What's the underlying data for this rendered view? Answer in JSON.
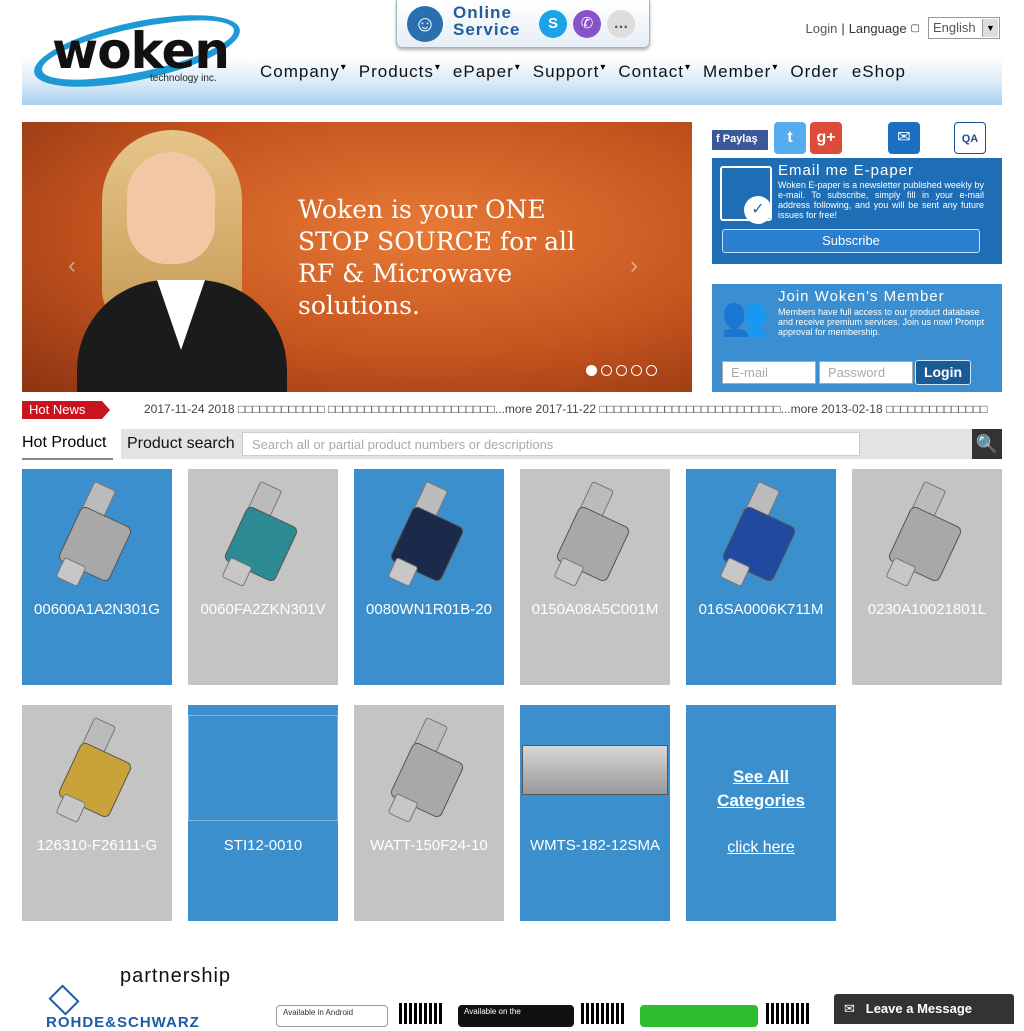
{
  "brand": {
    "logo_word": "woken",
    "logo_sub": "technology inc."
  },
  "online_service": {
    "line1": "Online",
    "line2": "Service"
  },
  "toplinks": {
    "login": "Login",
    "separator": "|",
    "language_label": "Language",
    "language_value": "English"
  },
  "nav": [
    {
      "label": "Company",
      "caret": "▾"
    },
    {
      "label": "Products",
      "caret": "▾"
    },
    {
      "label": "ePaper",
      "caret": "▾"
    },
    {
      "label": "Support",
      "caret": "▾"
    },
    {
      "label": "Contact",
      "caret": "▾"
    },
    {
      "label": "Member",
      "caret": "▾"
    },
    {
      "label": "Order",
      "caret": ""
    },
    {
      "label": "eShop",
      "caret": ""
    }
  ],
  "banner": {
    "slogan_lines": [
      "Woken is your ONE",
      "STOP SOURCE for all",
      "RF & Microwave",
      "solutions."
    ],
    "prev": "‹",
    "next": "›",
    "slide_count": 5,
    "active_slide": 1
  },
  "social": {
    "facebook": "Paylaş"
  },
  "epaper": {
    "title": "Email me E-paper",
    "desc": "Woken E-paper is a newsletter published weekly by e-mail. To subscribe, simply fill in your e-mail address following, and you will be sent any future issues for free!",
    "button": "Subscribe"
  },
  "member": {
    "title": "Join Woken's Member",
    "desc": "Members have full access to our product database and receive premium services. Join us now! Prompt approval for membership.",
    "email_placeholder": "E-mail",
    "password_placeholder": "Password",
    "login": "Login"
  },
  "hotnews": {
    "badge": "Hot News",
    "ticker": "2017-11-24 2018 □□□□□□□□□□□□ □□□□□□□□□□□□□□□□□□□□□□□...more   2017-11-22 □□□□□□□□□□□□□□□□□□□□□□□□□...more   2013-02-18 □□□□□□□□□□□□□□"
  },
  "search": {
    "hot_product": "Hot Product",
    "label": "Product search",
    "placeholder": "Search all or partial product numbers or descriptions",
    "button_icon": "magnifier-icon"
  },
  "products": [
    {
      "code": "00600A1A2N301G",
      "color": "blue"
    },
    {
      "code": "0060FA2ZKN301V",
      "color": "grey"
    },
    {
      "code": "0080WN1R01B-20",
      "color": "blue"
    },
    {
      "code": "0150A08A5C001M",
      "color": "grey"
    },
    {
      "code": "016SA0006K711M",
      "color": "blue"
    },
    {
      "code": "0230A10021801L",
      "color": "grey"
    },
    {
      "code": "126310-F26111-G",
      "color": "grey"
    },
    {
      "code": "STI12-0010",
      "color": "blue"
    },
    {
      "code": "WATT-150F24-10",
      "color": "grey"
    },
    {
      "code": "WMTS-182-12SMA",
      "color": "blue"
    }
  ],
  "see_all": {
    "line1": "See All",
    "line2": "Categories",
    "link": "click here"
  },
  "partnership": {
    "title": "partnership",
    "rs": "ROHDE&SCHWARZ",
    "android": "Available in Android",
    "appstore": "Available on the"
  },
  "leave_message": "Leave a Message",
  "colors": {
    "blue": "#3a8fcc",
    "grey": "#c4c4c4",
    "hotnews_red": "#c8141f",
    "epaper_blue": "#1f6eb5"
  }
}
